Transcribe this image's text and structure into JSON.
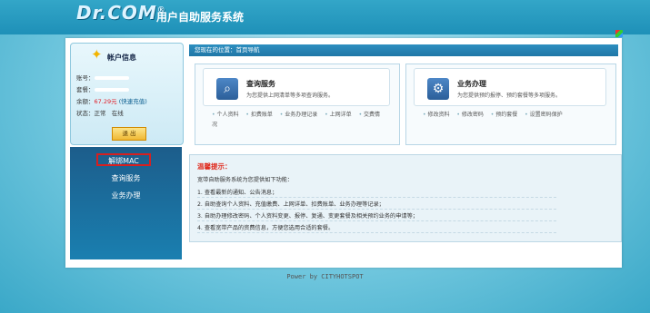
{
  "header": {
    "logo": "Dr.COM",
    "logo_mark": "®",
    "system_title": "用户自助服务系统"
  },
  "account": {
    "title": "帐户信息",
    "account_label": "账号：",
    "package_label": "套餐：",
    "balance_label": "余额：",
    "balance_value": "67.29元",
    "balance_link": "(快速充值)",
    "status_label": "状态：",
    "status_value": "正常",
    "online_value": "在线",
    "logout_label": "退 出"
  },
  "menu": {
    "items": [
      "解绑MAC",
      "查询服务",
      "业务办理"
    ]
  },
  "breadcrumb": "您现在的位置：首页导航",
  "query_service": {
    "title": "查询服务",
    "desc": "为您提供上网清单等多项查询服务。",
    "links": [
      "个人资料",
      "扣费账单",
      "业务办理记录",
      "上网详单",
      "交费情况"
    ]
  },
  "business_service": {
    "title": "业务办理",
    "desc": "为您提供预约报停、预约套餐等多项服务。",
    "links": [
      "修改资料",
      "修改密码",
      "预约套餐",
      "设置密码保护"
    ]
  },
  "tips": {
    "title": "温馨提示：",
    "intro": "宽带自助服务系统为您提供如下功能：",
    "lines": [
      "1. 查看最新的通知、公告消息；",
      "2. 自助查询个人资料、充值缴费、上网详单、扣费账单、业务办理等记录；",
      "3. 自助办理修改密码、个人资料变更、报停、复通、变更套餐及相关预约业务的申请等；",
      "4. 查看宽带产品的资费信息，方便您选用合适的套餐。"
    ]
  },
  "footer": "Power by CITYHOTSPOT",
  "colors": {
    "accent": "#1f76a6",
    "menu": "#1c5d8b",
    "tip_title": "#e02b1e"
  }
}
